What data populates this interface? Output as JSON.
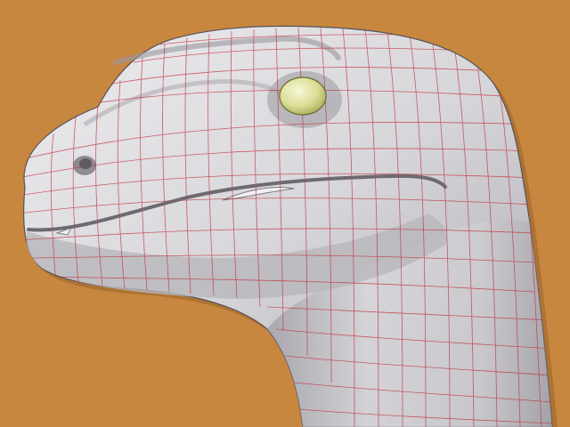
{
  "scene": {
    "subject": "dinosaur-head-wireframe-model",
    "colors": {
      "background": "#C8873F",
      "skin_light": "#E7E6E8",
      "skin_mid": "#C9C8CC",
      "skin_dark": "#8E8C92",
      "wire": "#C2303B",
      "eye_light": "#F4F6C8",
      "eye_dark": "#B7BC62",
      "mouth": "#6E6A70"
    }
  }
}
